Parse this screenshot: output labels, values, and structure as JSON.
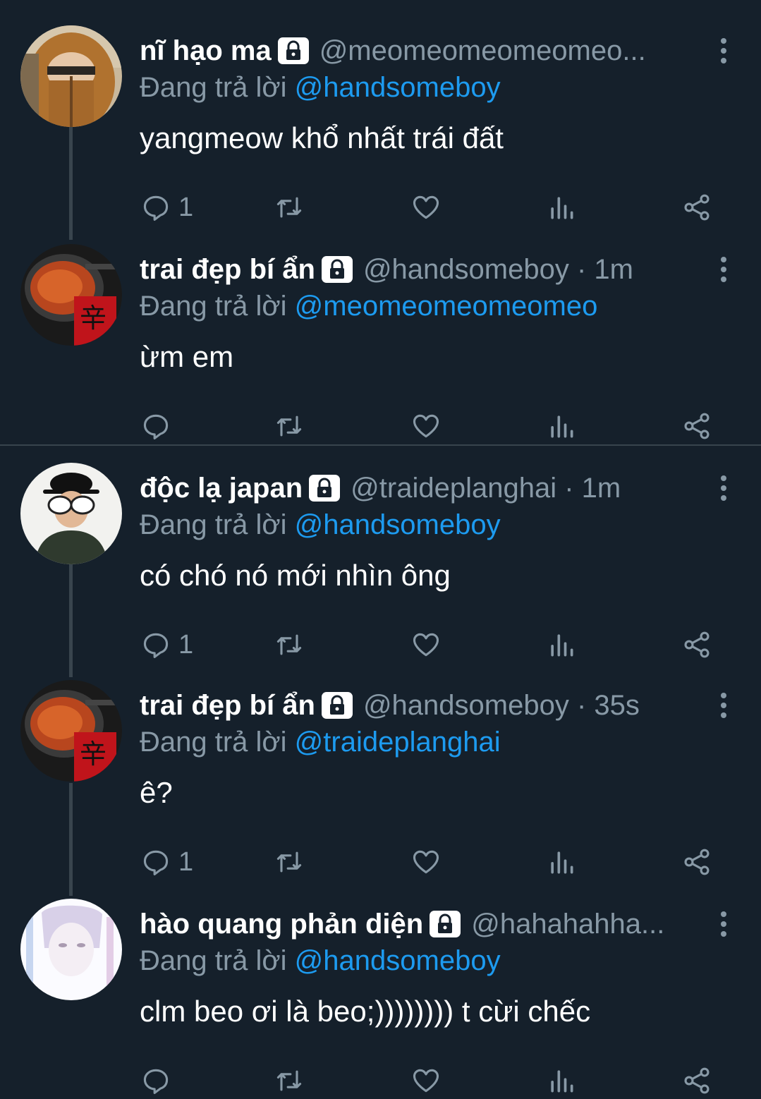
{
  "tweets": [
    {
      "name": "nĩ hạo ma",
      "handle": "@meomeomeomeomeo...",
      "replying_prefix": "Đang trả lời",
      "replying_to": "@handsomeboy",
      "text": "yangmeow khổ nhất trái đất",
      "reply_count": "1",
      "avatar_icon": "hooded-person-avatar"
    },
    {
      "name": "trai đẹp bí ẩn",
      "handle": "@handsomeboy · 1m",
      "replying_prefix": "Đang trả lời",
      "replying_to": "@meomeomeomeomeo",
      "text": "ừm em",
      "reply_count": "",
      "avatar_icon": "noodle-pot-avatar"
    },
    {
      "name": "độc lạ japan",
      "handle": "@traideplanghai · 1m",
      "replying_prefix": "Đang trả lời",
      "replying_to": "@handsomeboy",
      "text": "có chó nó mới nhìn ông",
      "reply_count": "1",
      "avatar_icon": "hat-sunglasses-avatar"
    },
    {
      "name": "trai đẹp bí ẩn",
      "handle": "@handsomeboy · 35s",
      "replying_prefix": "Đang trả lời",
      "replying_to": "@traideplanghai",
      "text": "ê?",
      "reply_count": "1",
      "avatar_icon": "noodle-pot-avatar"
    },
    {
      "name": "hào quang phản diện",
      "handle": "@hahahahha...",
      "replying_prefix": "Đang trả lời",
      "replying_to": "@handsomeboy",
      "text": "clm beo ơi là beo;)))))))) t cừi chếc",
      "reply_count": "",
      "avatar_icon": "faded-portrait-avatar"
    }
  ],
  "colors": {
    "background": "#15202b",
    "secondary_text": "#8899a6",
    "mention": "#1d9bf0",
    "divider": "#38444d"
  }
}
